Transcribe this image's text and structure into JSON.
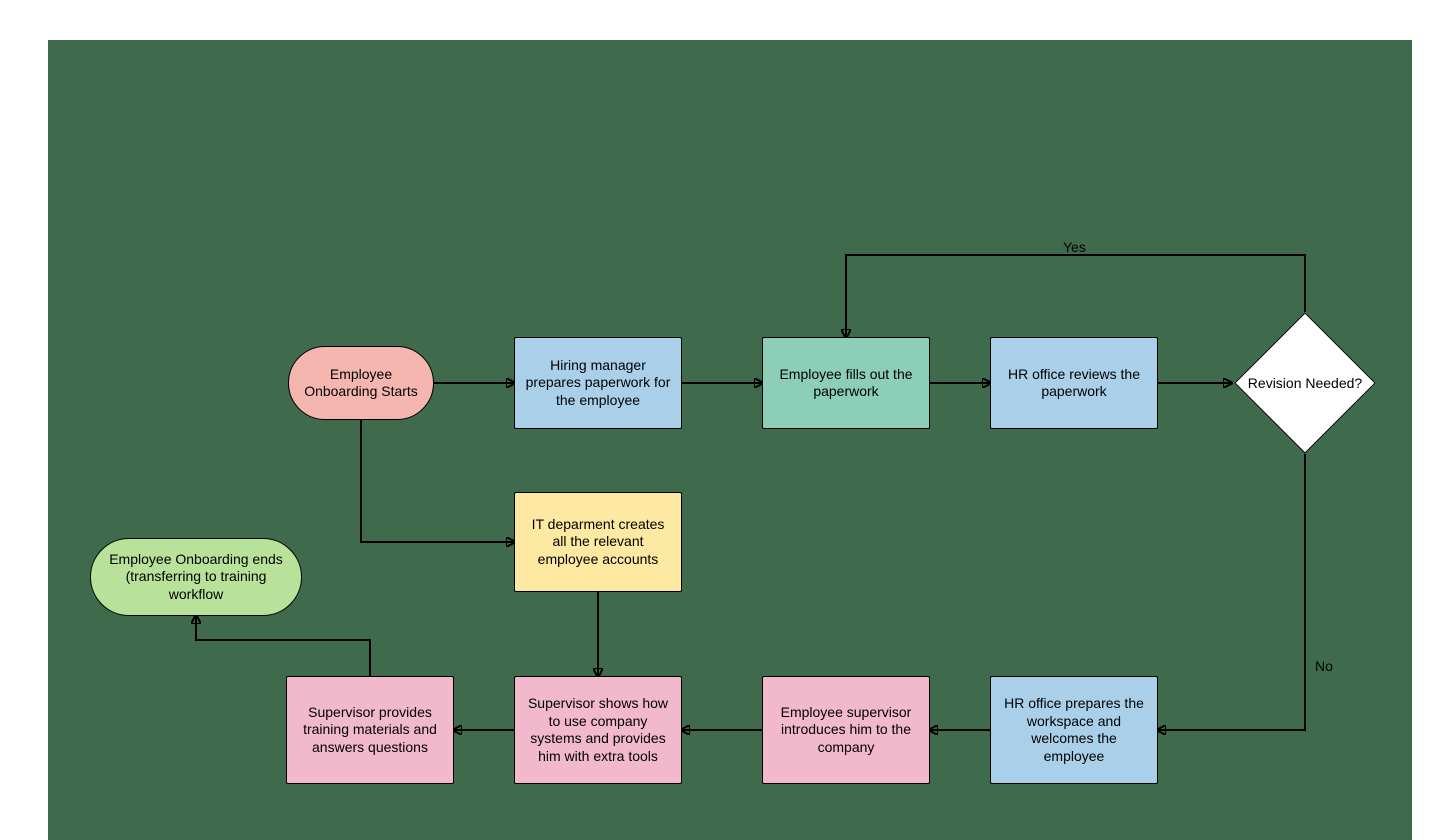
{
  "nodes": {
    "start": {
      "label": "Employee Onboarding Starts"
    },
    "hiring_mgr": {
      "label": "Hiring manager prepares paperwork for the employee"
    },
    "emp_fills": {
      "label": "Employee fills out the paperwork"
    },
    "hr_reviews": {
      "label": "HR office reviews the paperwork"
    },
    "revision": {
      "label": "Revision Needed?"
    },
    "it_dept": {
      "label": "IT deparment creates all the relevant employee accounts"
    },
    "end": {
      "label": "Employee Onboarding ends (transferring to training workflow"
    },
    "hr_workspace": {
      "label": "HR office prepares the workspace and welcomes the employee"
    },
    "supervisor_intro": {
      "label": "Employee supervisor introduces him to the company"
    },
    "supervisor_systems": {
      "label": "Supervisor shows how to use company systems and provides him with extra tools"
    },
    "supervisor_training": {
      "label": "Supervisor provides training materials and answers questions"
    }
  },
  "edges": {
    "yes": "Yes",
    "no": "No"
  },
  "colors": {
    "bg": "#3f6a4c",
    "start": "#f6b6b0",
    "blue": "#a9d0e8",
    "teal": "#8dceb8",
    "yellow": "#fde9a1",
    "pink": "#f1b9cb",
    "end": "#b8e29a",
    "white": "#ffffff"
  }
}
